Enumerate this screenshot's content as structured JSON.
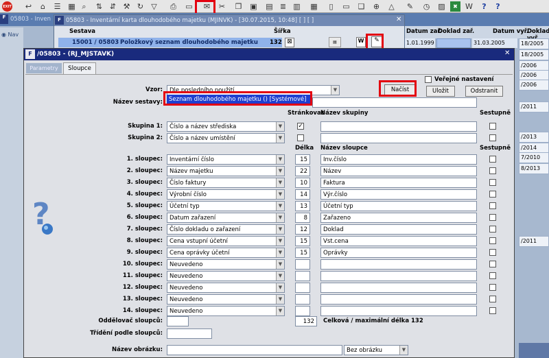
{
  "toolbar": {
    "exit_label": "EXIT",
    "icons": [
      "back-arrow-icon",
      "home-icon",
      "list-icon",
      "grid-icon",
      "search-icon",
      "sort-az-icon",
      "sort-za-icon",
      "wrench-icon",
      "refresh-icon",
      "filter-icon",
      "print-icon",
      "print-preview-icon",
      "mail-icon",
      "cut-icon",
      "copy-icon",
      "paste-icon",
      "paste-special-icon",
      "list-lines-icon",
      "insert-icon",
      "calc-icon",
      "doc-icon",
      "page-icon",
      "copy-doc-icon",
      "attach-icon",
      "warning-icon",
      "pencil-icon",
      "clock-icon",
      "chart-icon",
      "excel-icon",
      "word-icon",
      "help-icon",
      "help-cursor-icon"
    ]
  },
  "left_nav": {
    "label": "Nav",
    "code": "05803"
  },
  "background_window": {
    "title": "05803 - Inven",
    "columns": [
      "Datum zař.",
      "Doklad zař.",
      "Datum vyř.",
      "Doklad vyř"
    ],
    "row": [
      "1.01.1999",
      "",
      "31.03.2005",
      "18/2005"
    ],
    "right_cells": [
      "18/2005",
      "/2006",
      "/2006",
      "/2006",
      "/2011",
      "/2013",
      "/2014",
      "7/2010",
      "8/2013",
      "/2011"
    ]
  },
  "mid_window": {
    "title": "05803 - Inventární karta dlouhodobého majetku (MJINVK) - [30.07.2015, 10:48]  [ ]  [ ]",
    "col_sestava": "Sestava",
    "col_sirka": "Šířka",
    "code": "15001 / 05803",
    "name": "Položkový seznam dlouhodobého majetku",
    "width": "132"
  },
  "dialog": {
    "title": "/05803 - (RJ_MJSTAVK)",
    "tabs": [
      "Parametry",
      "Sloupce"
    ],
    "verejne_label": "Veřejné nastavení",
    "buttons": {
      "nacist": "Načíst",
      "ulozit": "Uložit",
      "odstranit": "Odstranit"
    },
    "vzor_label": "Vzor:",
    "vzor_value": "Dle posledního použití",
    "vzor_dropdown_item": "Seznam dlouhodobého majetku   ()   [Systémové]",
    "nazev_sestavy_label": "Název sestavy:",
    "hdr_strankovat": "Stránkovat",
    "hdr_nazev_skupiny": "Název skupiny",
    "hdr_sestupne": "Sestupně",
    "hdr_delka": "Délka",
    "hdr_nazev_sloupce": "Název sloupce",
    "groups": [
      {
        "label": "Skupina 1:",
        "value": "Číslo a název střediska",
        "checked": true
      },
      {
        "label": "Skupina 2:",
        "value": "Číslo a název umístění",
        "checked": false
      }
    ],
    "columns": [
      {
        "label": "1. sloupec:",
        "value": "Inventární číslo",
        "len": "15",
        "name": "Inv.číslo"
      },
      {
        "label": "2. sloupec:",
        "value": "Název majetku",
        "len": "22",
        "name": "Název"
      },
      {
        "label": "3. sloupec:",
        "value": "Číslo faktury",
        "len": "10",
        "name": "Faktura"
      },
      {
        "label": "4. sloupec:",
        "value": "Výrobní číslo",
        "len": "14",
        "name": "Výr.číslo"
      },
      {
        "label": "5. sloupec:",
        "value": "Účetní typ",
        "len": "13",
        "name": "Účetní typ"
      },
      {
        "label": "6. sloupec:",
        "value": "Datum zařazení",
        "len": "8",
        "name": "Zařazeno"
      },
      {
        "label": "7. sloupec:",
        "value": "Číslo dokladu o zařazení",
        "len": "12",
        "name": "Doklad"
      },
      {
        "label": "8. sloupec:",
        "value": "Cena vstupní účetní",
        "len": "15",
        "name": "Vst.cena"
      },
      {
        "label": "9. sloupec:",
        "value": "Cena oprávky účetní",
        "len": "15",
        "name": "Oprávky"
      },
      {
        "label": "10. sloupec:",
        "value": "Neuvedeno",
        "len": "",
        "name": ""
      },
      {
        "label": "11. sloupec:",
        "value": "Neuvedeno",
        "len": "",
        "name": ""
      },
      {
        "label": "12. sloupec:",
        "value": "Neuvedeno",
        "len": "",
        "name": ""
      },
      {
        "label": "13. sloupec:",
        "value": "Neuvedeno",
        "len": "",
        "name": ""
      },
      {
        "label": "14. sloupec:",
        "value": "Neuvedeno",
        "len": "",
        "name": ""
      }
    ],
    "oddelovac_label": "Oddělovač sloupců:",
    "total_value": "132",
    "total_label": "Celková / maximální délka 132",
    "trideni_label": "Třídění podle sloupců:",
    "nazev_obrazku_label": "Název obrázku:",
    "obrazek_value": "Bez obrázku"
  },
  "colors": {
    "highlight": "#e3000f",
    "dialog_title": "#192a7d",
    "selection": "#1f3fd0"
  }
}
